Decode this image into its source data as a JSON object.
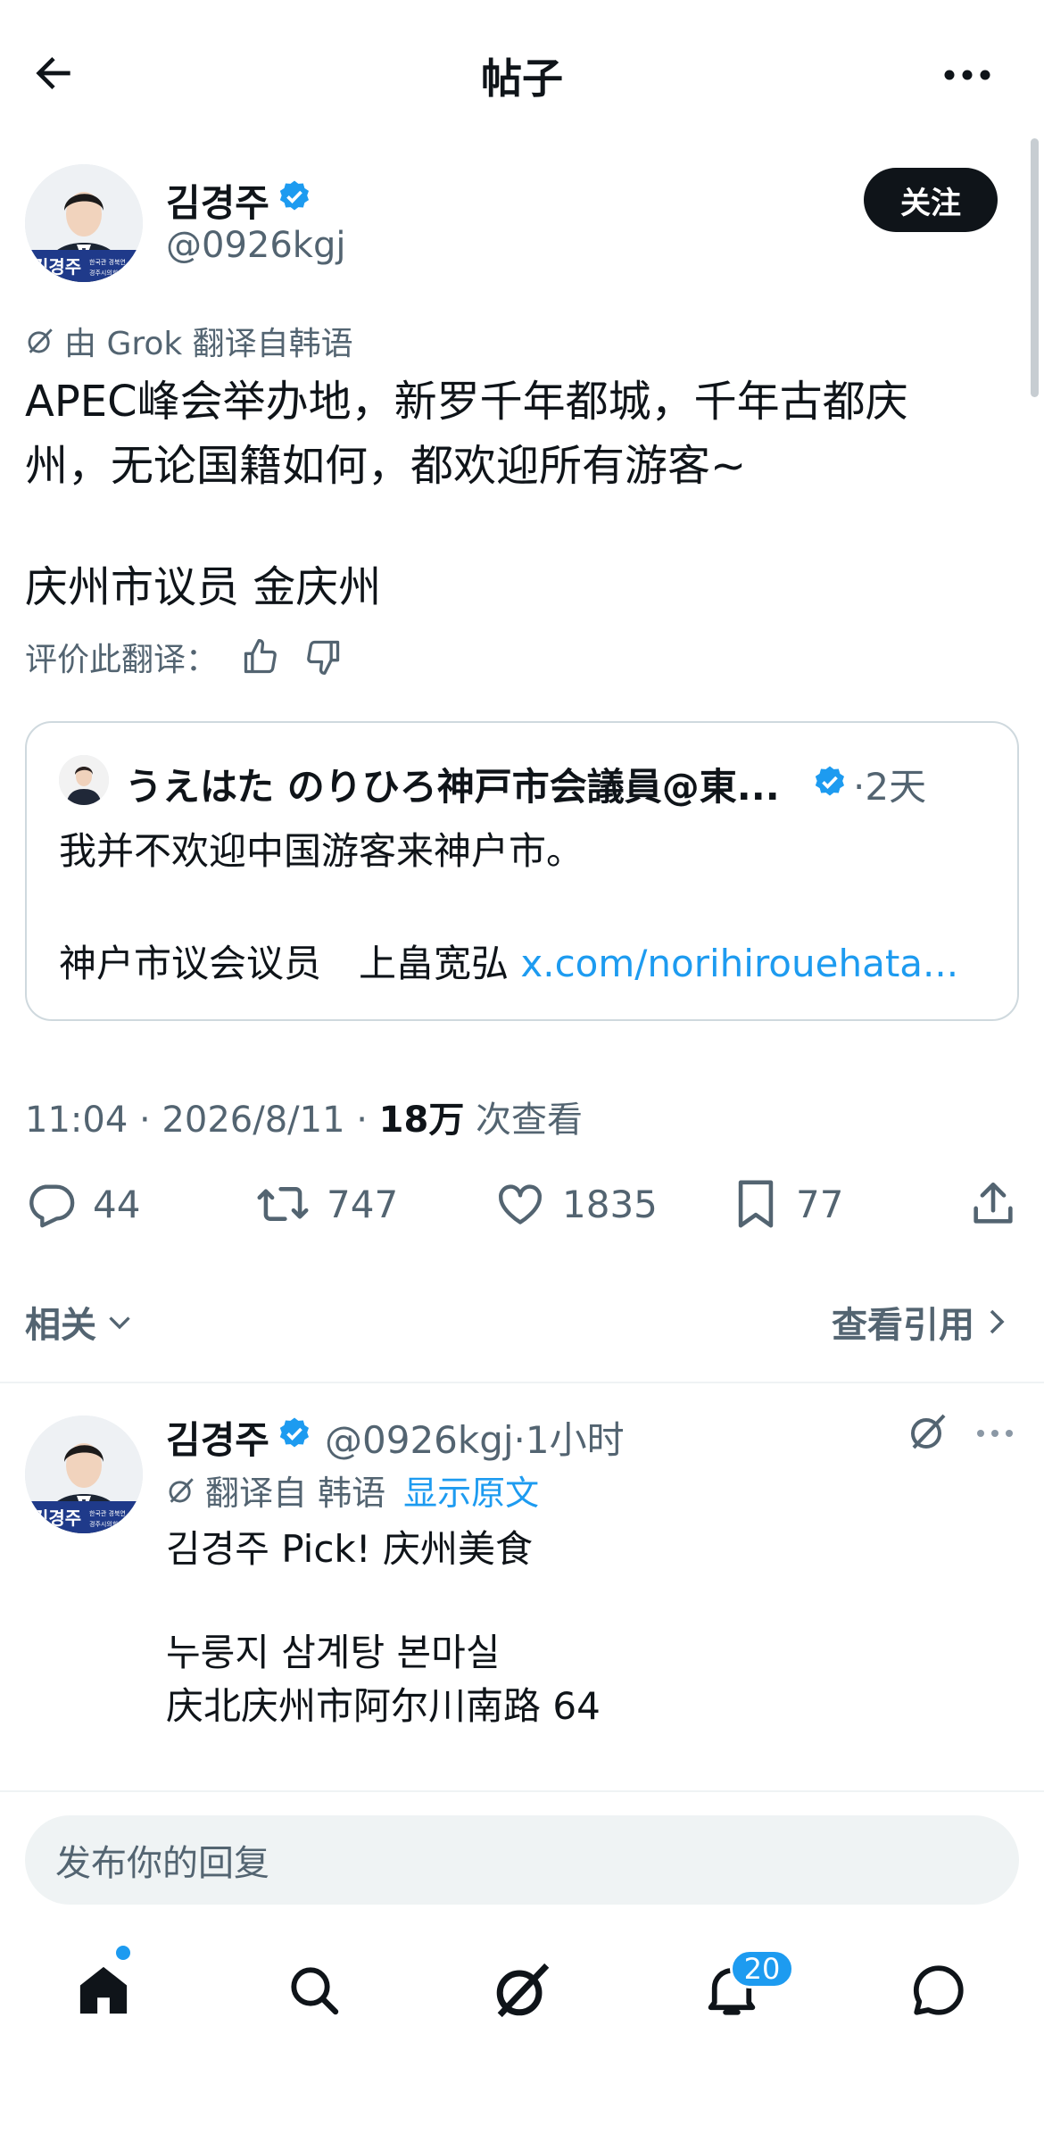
{
  "header": {
    "title": "帖子",
    "back_icon": "arrow-left-icon",
    "more_icon": "more-horizontal-icon"
  },
  "post": {
    "author_name": "김경주",
    "author_handle": "@0926kgj",
    "follow_label": "关注",
    "translated_by": "由 Grok 翻译自韩语",
    "text_lines": [
      "APEC峰会举办地，新罗千年都城，千年古都庆",
      "州，无论国籍如何，都欢迎所有游客~",
      "",
      "庆州市议员 金庆州"
    ],
    "rate_translation_label": "评价此翻译：",
    "avatar_caption": "김경주",
    "avatar_sub": "한국관 경북연 경주시의회"
  },
  "quote": {
    "author_name": "うえはた のりひろ神戸市会議員@東...",
    "time": "·2天",
    "text": "我并不欢迎中国游客来神户市。",
    "sign_prefix": "神户市议会议员　上畠宽弘 ",
    "link": "x.com/norihirouehata..."
  },
  "meta": {
    "time_date": "11:04 · 2026/8/11 · ",
    "views_count": "18万",
    "views_label": " 次查看"
  },
  "stats": {
    "replies": "44",
    "reposts": "747",
    "likes": "1835",
    "bookmarks": "77"
  },
  "related": {
    "label": "相关",
    "view_quotes": "查看引用"
  },
  "reply": {
    "author_name": "김경주",
    "handle_time": "@0926kgj·1小时",
    "translated_from": "翻译自 韩语",
    "show_original": "显示原文",
    "text_lines": [
      "김경주 Pick! 庆州美食",
      "",
      "누룽지 삼계탕 본마실",
      "庆北庆州市阿尔川南路 64"
    ]
  },
  "composer": {
    "placeholder": "发布你的回复"
  },
  "tabbar": {
    "notifications_badge": "20",
    "items": [
      "home-icon",
      "search-icon",
      "grok-icon",
      "notifications-icon",
      "messages-icon"
    ]
  },
  "colors": {
    "accent": "#1d9bf0",
    "text": "#0f1419",
    "muted": "#536471",
    "border": "#cfd9de"
  }
}
